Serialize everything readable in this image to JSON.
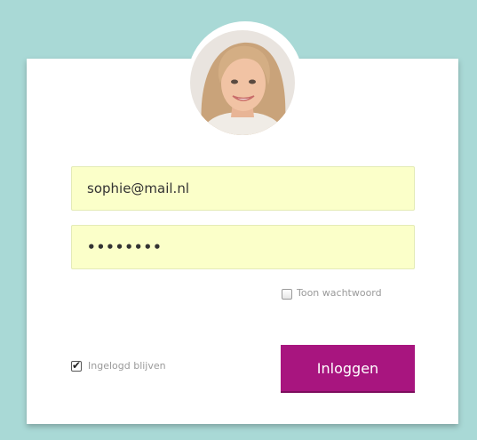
{
  "login": {
    "email_value": "sophie@mail.nl",
    "password_value": "••••••••",
    "show_password_label": "Toon wachtwoord",
    "show_password_checked": false,
    "stay_logged_in_label": "Ingelogd blijven",
    "stay_logged_in_checked": true,
    "checkmark_glyph": "✔",
    "submit_label": "Inloggen"
  },
  "avatar": {
    "icon": "profile-photo"
  },
  "colors": {
    "background": "#a9d9d6",
    "card": "#ffffff",
    "field_fill": "#fbffc9",
    "button": "#a8157f",
    "label_text": "#9a9a9a"
  }
}
